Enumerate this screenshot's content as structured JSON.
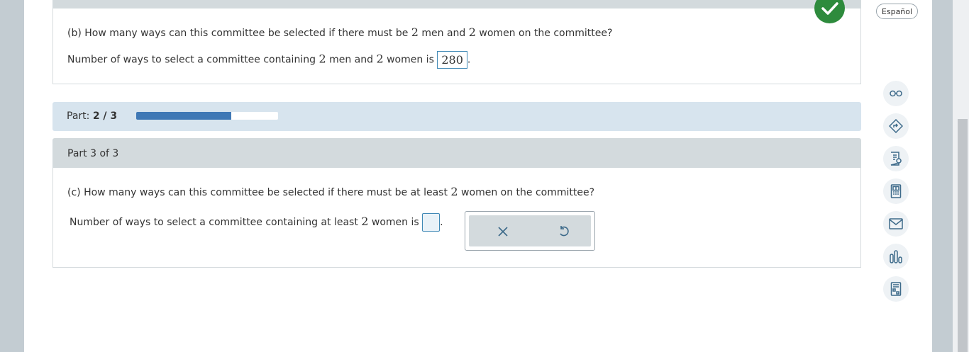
{
  "part_b": {
    "question_prefix": "(b) How many ways can this committee be selected if there must be ",
    "n1": "2",
    "mid1": " men and ",
    "n2": "2",
    "question_suffix": " women on the committee?",
    "answer_prefix": "Number of ways to select a committee containing ",
    "a_n1": "2",
    "a_mid": " men and ",
    "a_n2": "2",
    "a_suffix": " women is ",
    "answer_value": "280",
    "period": "."
  },
  "progress": {
    "label": "Part: ",
    "value": "2 / 3",
    "fraction": 0.67,
    "fill_color": "#3f78b5"
  },
  "part_c_header": "Part 3 of 3",
  "part_c": {
    "question_prefix": "(c) How many ways can this committee be selected if there must be at least ",
    "n1": "2",
    "question_suffix": " women on the committee?",
    "answer_prefix": "Number of ways to select a committee containing at least ",
    "a_n1": "2",
    "a_suffix": " women is ",
    "period": "."
  },
  "rail": {
    "language_button": "Español",
    "icons": [
      "glasses-icon",
      "directions-icon",
      "notes-icon",
      "calculator-icon",
      "mail-icon",
      "bar-chart-icon",
      "worksheet-icon"
    ]
  },
  "colors": {
    "correct_green": "#2e8b3d",
    "accent_blue": "#3f88b5",
    "progress_strip": "#d7e4ee"
  }
}
